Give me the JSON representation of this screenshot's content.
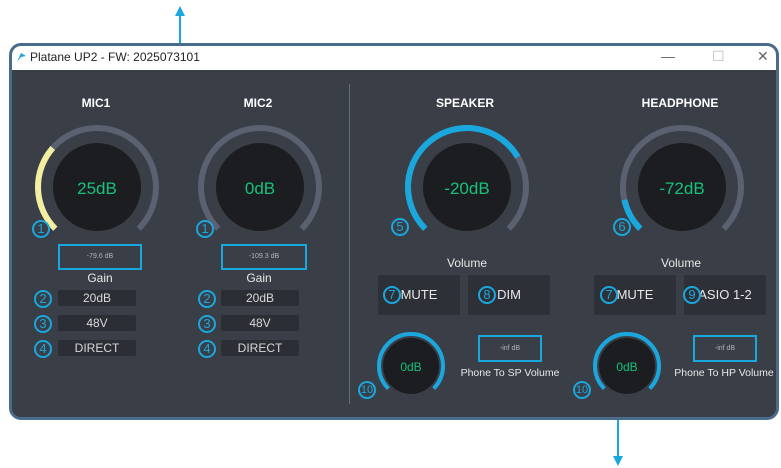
{
  "window": {
    "title": "Platane UP2 - FW: 2025073101",
    "minimize": "—",
    "maximize": "☐",
    "close": "✕"
  },
  "mic1": {
    "header": "MIC1",
    "gain_display": "25dB",
    "gain_level": 0.32,
    "meter": "-79.6 dB",
    "gain_label": "Gain",
    "gain_step": "20dB",
    "phantom": "48V",
    "direct": "DIRECT"
  },
  "mic2": {
    "header": "MIC2",
    "gain_display": "0dB",
    "gain_level": 0.0,
    "meter": "-109.3 dB",
    "gain_label": "Gain",
    "gain_step": "20dB",
    "phantom": "48V",
    "direct": "DIRECT"
  },
  "speaker": {
    "header": "SPEAKER",
    "volume_display": "-20dB",
    "volume_level": 0.72,
    "volume_label": "Volume",
    "mute": "MUTE",
    "dim": "DIM",
    "phone_display": "0dB",
    "phone_level": 1.0,
    "phone_meter": "-inf dB",
    "phone_label": "Phone To SP Volume"
  },
  "headphone": {
    "header": "HEADPHONE",
    "volume_display": "-72dB",
    "volume_level": 0.12,
    "volume_label": "Volume",
    "mute": "MUTE",
    "asio": "ASIO 1-2",
    "phone_display": "0dB",
    "phone_level": 1.0,
    "phone_meter": "-inf dB",
    "phone_label": "Phone To HP Volume"
  },
  "callouts": [
    "1",
    "1",
    "2",
    "2",
    "3",
    "3",
    "4",
    "4",
    "5",
    "6",
    "7",
    "7",
    "8",
    "9",
    "10",
    "10"
  ],
  "colors": {
    "panel": "#3a3e47",
    "accent": "#1aa7de",
    "mic_arc": "#f3eea0",
    "value_text": "#16c27a"
  }
}
